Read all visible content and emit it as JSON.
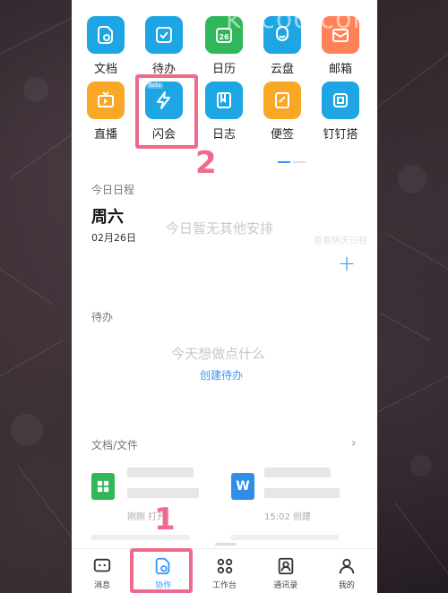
{
  "watermark": "khcoo.com",
  "apps": [
    {
      "label": "文档",
      "color": "#1ea5e4",
      "icon": "doc-icon"
    },
    {
      "label": "待办",
      "color": "#1ea5e4",
      "icon": "todo-check-icon"
    },
    {
      "label": "日历",
      "color": "#2fb75a",
      "icon": "calendar-icon",
      "badge": "26"
    },
    {
      "label": "云盘",
      "color": "#1ea5e4",
      "icon": "cloud-icon"
    },
    {
      "label": "邮箱",
      "color": "#ff8158",
      "icon": "mail-icon"
    },
    {
      "label": "直播",
      "color": "#f9a825",
      "icon": "tv-icon"
    },
    {
      "label": "闪会",
      "color": "#1ea5e4",
      "icon": "flash-icon",
      "tag": "Beta"
    },
    {
      "label": "日志",
      "color": "#1ea5e4",
      "icon": "log-icon"
    },
    {
      "label": "便签",
      "color": "#f9a825",
      "icon": "note-icon"
    },
    {
      "label": "钉钉搭",
      "color": "#1ea5e4",
      "icon": "build-icon"
    }
  ],
  "schedule": {
    "label": "今日日程",
    "weekday": "周六",
    "date": "02月26日",
    "empty": "今日暂无其他安排",
    "faded_hint": "查看明天日程"
  },
  "todo": {
    "label": "待办",
    "empty": "今天想做点什么",
    "create": "创建待办"
  },
  "files": {
    "label": "文档/文件",
    "items": [
      {
        "icon": "sheet-icon",
        "color": "#2fb75a",
        "meta": "刚刚 打开"
      },
      {
        "icon": "word-icon",
        "color": "#2f8ee8",
        "icon_text": "W",
        "meta": "15:02 创建"
      }
    ]
  },
  "tabs": [
    {
      "label": "消息",
      "icon": "message-icon"
    },
    {
      "label": "协作",
      "icon": "collab-icon",
      "active": true
    },
    {
      "label": "工作台",
      "icon": "workbench-icon"
    },
    {
      "label": "通讯录",
      "icon": "contacts-icon"
    },
    {
      "label": "我的",
      "icon": "profile-icon"
    }
  ],
  "annotations": {
    "step1": "1",
    "step2": "2"
  },
  "colors": {
    "accent": "#3296fa",
    "highlight": "#f06a8c"
  }
}
